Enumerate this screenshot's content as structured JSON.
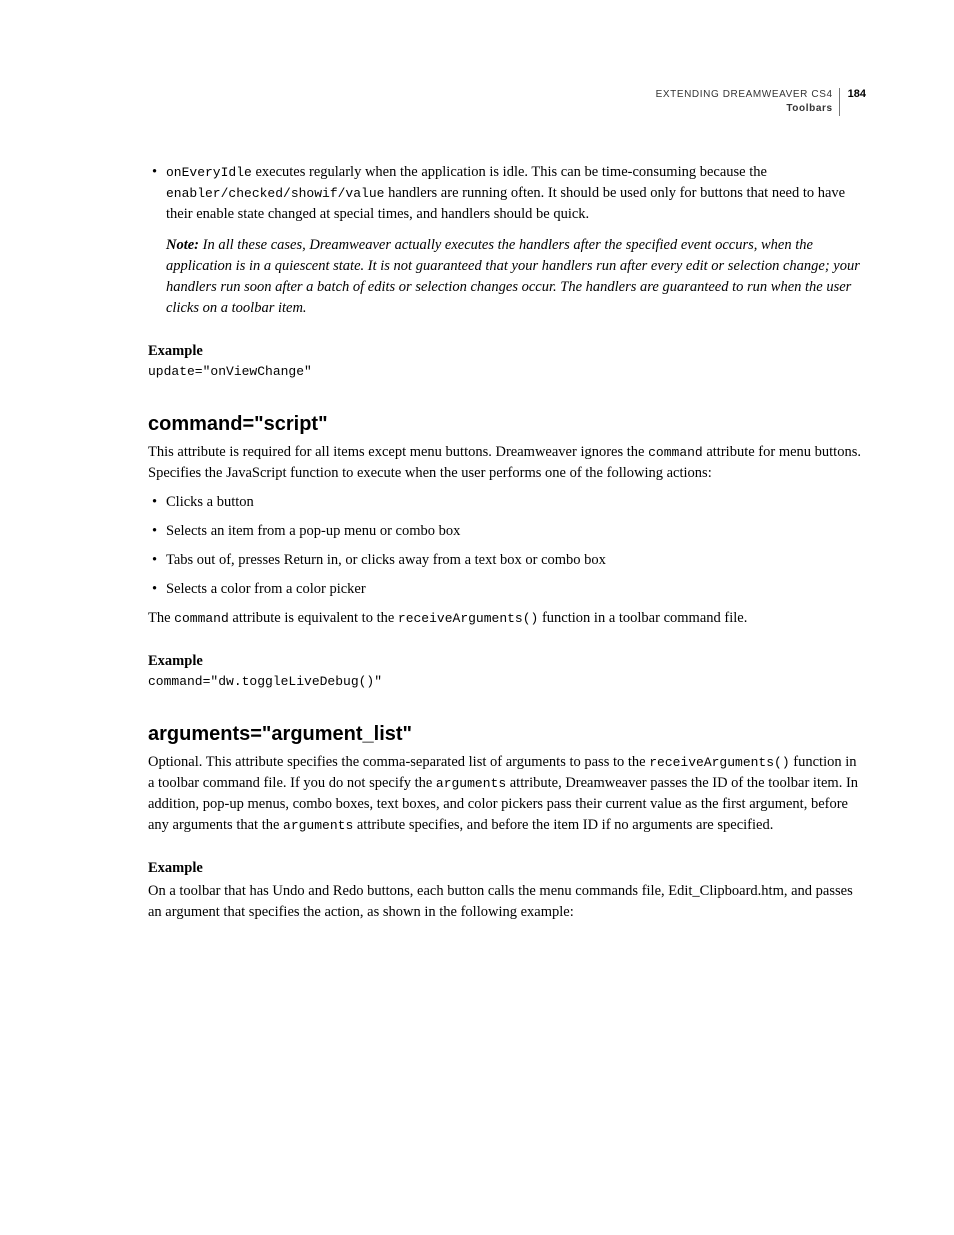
{
  "header": {
    "title": "EXTENDING DREAMWEAVER CS4",
    "section": "Toolbars",
    "page": "184"
  },
  "block1": {
    "bullet_pre_code": "onEveryIdle",
    "bullet_text_1": " executes regularly when the application is idle. This can be time-consuming because the ",
    "bullet_code_2": "enabler/checked/showif/value",
    "bullet_text_2": " handlers are running often. It should be used only for buttons that need to have their enable state changed at special times, and handlers should be quick.",
    "note_label": "Note:",
    "note_text": " In all these cases, Dreamweaver actually executes the handlers after the specified event occurs, when the application is in a quiescent state. It is not guaranteed that your handlers run after every edit or selection change; your handlers run soon after a batch of edits or selection changes occur. The handlers are guaranteed to run when the user clicks on a toolbar item."
  },
  "example1": {
    "label": "Example",
    "code": "update=\"onViewChange\""
  },
  "section2": {
    "heading": "command=\"script\"",
    "para_pre": "This attribute is required for all items except menu buttons. Dreamweaver ignores the ",
    "para_code": "command",
    "para_post": " attribute for menu buttons. Specifies the JavaScript function to execute when the user performs one of the following actions:",
    "bullets": [
      "Clicks a button",
      "Selects an item from a pop-up menu or combo box",
      "Tabs out of, presses Return in, or clicks away from a text box or combo box",
      "Selects a color from a color picker"
    ],
    "closing_pre": "The ",
    "closing_code1": "command",
    "closing_mid": " attribute is equivalent to the ",
    "closing_code2": "receiveArguments()",
    "closing_post": " function in a toolbar command file."
  },
  "example2": {
    "label": "Example",
    "code": "command=\"dw.toggleLiveDebug()\""
  },
  "section3": {
    "heading": "arguments=\"argument_list\"",
    "p1_pre": "Optional. This attribute specifies the comma-separated list of arguments to pass to the ",
    "p1_code1": "receiveArguments()",
    "p1_mid1": " function in a toolbar command file. If you do not specify the ",
    "p1_code2": "arguments",
    "p1_mid2": " attribute, Dreamweaver passes the ID of the toolbar item. In addition, pop-up menus, combo boxes, text boxes, and color pickers pass their current value as the first argument, before any arguments that the ",
    "p1_code3": "arguments",
    "p1_post": " attribute specifies, and before the item ID if no arguments are specified."
  },
  "example3": {
    "label": "Example",
    "text": "On a toolbar that has Undo and Redo buttons, each button calls the menu commands file, Edit_Clipboard.htm, and passes an argument that specifies the action, as shown in the following example:"
  }
}
